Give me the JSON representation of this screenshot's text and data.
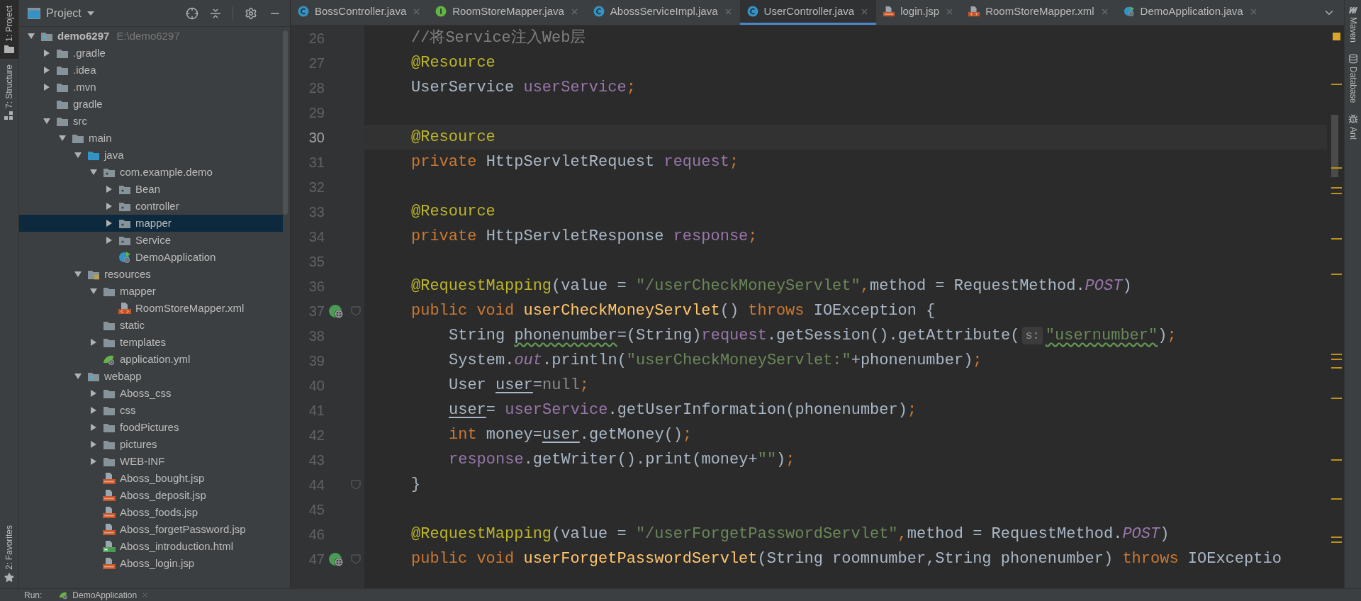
{
  "left_strip": [
    {
      "label": "1: Project",
      "selected": true,
      "kind": "project"
    },
    {
      "label": "7: Structure",
      "selected": false,
      "kind": "structure"
    }
  ],
  "left_strip_bottom": [
    {
      "label": "2: Favorites",
      "selected": false,
      "kind": "favorites"
    }
  ],
  "project_panel": {
    "title": "Project"
  },
  "tree": [
    {
      "name": "demo6297",
      "path": "E:\\demo6297",
      "kind": "module",
      "expanded": true,
      "selected": false,
      "children": [
        {
          "name": ".gradle",
          "kind": "folder",
          "expanded": false,
          "selected": false
        },
        {
          "name": ".idea",
          "kind": "folder",
          "expanded": false,
          "selected": false
        },
        {
          "name": ".mvn",
          "kind": "folder",
          "expanded": false,
          "selected": false
        },
        {
          "name": "gradle",
          "kind": "folder",
          "selected": false
        },
        {
          "name": "src",
          "kind": "folder",
          "expanded": true,
          "selected": false,
          "children": [
            {
              "name": "main",
              "kind": "folder",
              "expanded": true,
              "selected": false,
              "children": [
                {
                  "name": "java",
                  "kind": "source",
                  "expanded": true,
                  "selected": false,
                  "children": [
                    {
                      "name": "com.example.demo",
                      "kind": "package",
                      "expanded": true,
                      "selected": false,
                      "children": [
                        {
                          "name": "Bean",
                          "kind": "package",
                          "expanded": false,
                          "selected": false
                        },
                        {
                          "name": "controller",
                          "kind": "package",
                          "expanded": false,
                          "selected": false
                        },
                        {
                          "name": "mapper",
                          "kind": "package",
                          "expanded": false,
                          "selected": true
                        },
                        {
                          "name": "Service",
                          "kind": "package",
                          "expanded": false,
                          "selected": false
                        },
                        {
                          "name": "DemoApplication",
                          "kind": "boot",
                          "selected": false
                        }
                      ]
                    }
                  ]
                },
                {
                  "name": "resources",
                  "kind": "resources",
                  "expanded": true,
                  "selected": false,
                  "children": [
                    {
                      "name": "mapper",
                      "kind": "folder",
                      "expanded": true,
                      "selected": false,
                      "children": [
                        {
                          "name": "RoomStoreMapper.xml",
                          "kind": "xml",
                          "selected": false
                        }
                      ]
                    },
                    {
                      "name": "static",
                      "kind": "folder",
                      "selected": false
                    },
                    {
                      "name": "templates",
                      "kind": "folder",
                      "expanded": false,
                      "selected": false
                    },
                    {
                      "name": "application.yml",
                      "kind": "yml",
                      "selected": false
                    }
                  ]
                },
                {
                  "name": "webapp",
                  "kind": "web",
                  "expanded": true,
                  "selected": false,
                  "children": [
                    {
                      "name": "Aboss_css",
                      "kind": "folder",
                      "expanded": false,
                      "selected": false
                    },
                    {
                      "name": "css",
                      "kind": "folder",
                      "expanded": false,
                      "selected": false
                    },
                    {
                      "name": "foodPictures",
                      "kind": "folder",
                      "expanded": false,
                      "selected": false
                    },
                    {
                      "name": "pictures",
                      "kind": "folder",
                      "expanded": false,
                      "selected": false
                    },
                    {
                      "name": "WEB-INF",
                      "kind": "folder",
                      "expanded": false,
                      "selected": false
                    },
                    {
                      "name": "Aboss_bought.jsp",
                      "kind": "jsp",
                      "selected": false
                    },
                    {
                      "name": "Aboss_deposit.jsp",
                      "kind": "jsp",
                      "selected": false
                    },
                    {
                      "name": "Aboss_foods.jsp",
                      "kind": "jsp",
                      "selected": false
                    },
                    {
                      "name": "Aboss_forgetPassword.jsp",
                      "kind": "jsp",
                      "selected": false
                    },
                    {
                      "name": "Aboss_introduction.html",
                      "kind": "html",
                      "selected": false
                    },
                    {
                      "name": "Aboss_login.jsp",
                      "kind": "jsp",
                      "selected": false
                    }
                  ]
                }
              ]
            }
          ]
        }
      ]
    }
  ],
  "tabs": [
    {
      "label": "BossController.java",
      "kind": "class",
      "selected": false
    },
    {
      "label": "RoomStoreMapper.java",
      "kind": "interface",
      "selected": false
    },
    {
      "label": "AbossServiceImpl.java",
      "kind": "class",
      "selected": false
    },
    {
      "label": "UserController.java",
      "kind": "class",
      "selected": true
    },
    {
      "label": "login.jsp",
      "kind": "jsp",
      "selected": false
    },
    {
      "label": "RoomStoreMapper.xml",
      "kind": "xml",
      "selected": false
    },
    {
      "label": "DemoApplication.java",
      "kind": "boot",
      "selected": false
    }
  ],
  "code_lines": [
    {
      "number": "26",
      "kind": "member",
      "current": false,
      "run_icon": false,
      "fold": false,
      "tokens": [
        {
          "kind": "comment",
          "text": "//将Service注入Web层"
        }
      ]
    },
    {
      "number": "27",
      "kind": "member",
      "current": false,
      "run_icon": false,
      "fold": false,
      "tokens": [
        {
          "kind": "annotation",
          "text": "@Resource"
        }
      ]
    },
    {
      "number": "28",
      "kind": "member",
      "current": false,
      "run_icon": false,
      "fold": false,
      "tokens": [
        {
          "kind": "plain",
          "text": "UserService "
        },
        {
          "kind": "field",
          "text": "userService"
        },
        {
          "kind": "keyword",
          "text": ";"
        }
      ]
    },
    {
      "number": "29",
      "kind": "blank",
      "current": false,
      "run_icon": false,
      "fold": false
    },
    {
      "number": "30",
      "kind": "member",
      "current": true,
      "run_icon": false,
      "fold": false,
      "tokens": [
        {
          "kind": "annotation",
          "text": "@Resource"
        }
      ]
    },
    {
      "number": "31",
      "kind": "member",
      "current": false,
      "run_icon": false,
      "fold": false,
      "tokens": [
        {
          "kind": "keyword",
          "text": "private "
        },
        {
          "kind": "plain",
          "text": "HttpServletRequest "
        },
        {
          "kind": "field",
          "text": "request"
        },
        {
          "kind": "keyword",
          "text": ";"
        }
      ]
    },
    {
      "number": "32",
      "kind": "blank",
      "current": false,
      "run_icon": false,
      "fold": false
    },
    {
      "number": "33",
      "kind": "member",
      "current": false,
      "run_icon": false,
      "fold": false,
      "tokens": [
        {
          "kind": "annotation",
          "text": "@Resource"
        }
      ]
    },
    {
      "number": "34",
      "kind": "member",
      "current": false,
      "run_icon": false,
      "fold": false,
      "tokens": [
        {
          "kind": "keyword",
          "text": "private "
        },
        {
          "kind": "plain",
          "text": "HttpServletResponse "
        },
        {
          "kind": "field",
          "text": "response"
        },
        {
          "kind": "keyword",
          "text": ";"
        }
      ]
    },
    {
      "number": "35",
      "kind": "blank",
      "current": false,
      "run_icon": false,
      "fold": false
    },
    {
      "number": "36",
      "kind": "member",
      "current": false,
      "run_icon": false,
      "fold": false,
      "tokens": [
        {
          "kind": "annotation",
          "text": "@RequestMapping"
        },
        {
          "kind": "plain",
          "text": "(value = "
        },
        {
          "kind": "string",
          "text": "\"/userCheckMoneyServlet\""
        },
        {
          "kind": "keyword",
          "text": ","
        },
        {
          "kind": "plain",
          "text": "method = RequestMethod."
        },
        {
          "kind": "static",
          "text": "POST"
        },
        {
          "kind": "plain",
          "text": ")"
        }
      ]
    },
    {
      "number": "37",
      "kind": "member",
      "current": false,
      "run_icon": true,
      "fold": true,
      "tokens": [
        {
          "kind": "keyword",
          "text": "public void "
        },
        {
          "kind": "method",
          "text": "userCheckMoneyServlet"
        },
        {
          "kind": "plain",
          "text": "() "
        },
        {
          "kind": "keyword",
          "text": "throws "
        },
        {
          "kind": "plain",
          "text": "IOException {"
        }
      ]
    },
    {
      "number": "38",
      "kind": "body",
      "current": false,
      "run_icon": false,
      "fold": false,
      "tokens": [
        {
          "kind": "plain",
          "text": "String "
        },
        {
          "kind": "typo",
          "text": "phonenumber"
        },
        {
          "kind": "plain",
          "text": "=(String)"
        },
        {
          "kind": "field",
          "text": "request"
        },
        {
          "kind": "plain",
          "text": ".getSession().getAttribute("
        },
        {
          "kind": "hint",
          "text": "s:"
        },
        {
          "kind": "typo_string",
          "text": "\"usernumber\""
        },
        {
          "kind": "plain",
          "text": ")"
        },
        {
          "kind": "keyword",
          "text": ";"
        }
      ]
    },
    {
      "number": "39",
      "kind": "body",
      "current": false,
      "run_icon": false,
      "fold": false,
      "tokens": [
        {
          "kind": "plain",
          "text": "System."
        },
        {
          "kind": "static",
          "text": "out"
        },
        {
          "kind": "plain",
          "text": ".println("
        },
        {
          "kind": "string",
          "text": "\"userCheckMoneyServlet:\""
        },
        {
          "kind": "plain",
          "text": "+phonenumber)"
        },
        {
          "kind": "keyword",
          "text": ";"
        }
      ]
    },
    {
      "number": "40",
      "kind": "body",
      "current": false,
      "run_icon": false,
      "fold": false,
      "tokens": [
        {
          "kind": "plain",
          "text": "User "
        },
        {
          "kind": "reassigned",
          "text": "user"
        },
        {
          "kind": "plain",
          "text": "="
        },
        {
          "kind": "null",
          "text": "null"
        },
        {
          "kind": "keyword",
          "text": ";"
        }
      ]
    },
    {
      "number": "41",
      "kind": "body",
      "current": false,
      "run_icon": false,
      "fold": false,
      "tokens": [
        {
          "kind": "reassigned",
          "text": "user"
        },
        {
          "kind": "plain",
          "text": "= "
        },
        {
          "kind": "field",
          "text": "userService"
        },
        {
          "kind": "plain",
          "text": ".getUserInformation(phonenumber)"
        },
        {
          "kind": "keyword",
          "text": ";"
        }
      ]
    },
    {
      "number": "42",
      "kind": "body",
      "current": false,
      "run_icon": false,
      "fold": false,
      "tokens": [
        {
          "kind": "keyword",
          "text": "int "
        },
        {
          "kind": "plain",
          "text": "money="
        },
        {
          "kind": "reassigned",
          "text": "user"
        },
        {
          "kind": "plain",
          "text": ".getMoney()"
        },
        {
          "kind": "keyword",
          "text": ";"
        }
      ]
    },
    {
      "number": "43",
      "kind": "body",
      "current": false,
      "run_icon": false,
      "fold": false,
      "tokens": [
        {
          "kind": "field",
          "text": "response"
        },
        {
          "kind": "plain",
          "text": ".getWriter().print(money+"
        },
        {
          "kind": "string",
          "text": "\"\""
        },
        {
          "kind": "plain",
          "text": ")"
        },
        {
          "kind": "keyword",
          "text": ";"
        }
      ]
    },
    {
      "number": "44",
      "kind": "member",
      "current": false,
      "run_icon": false,
      "fold": true,
      "tokens": [
        {
          "kind": "plain",
          "text": "}"
        }
      ]
    },
    {
      "number": "45",
      "kind": "blank",
      "current": false,
      "run_icon": false,
      "fold": false
    },
    {
      "number": "46",
      "kind": "member",
      "current": false,
      "run_icon": false,
      "fold": false,
      "tokens": [
        {
          "kind": "annotation",
          "text": "@RequestMapping"
        },
        {
          "kind": "plain",
          "text": "(value = "
        },
        {
          "kind": "string",
          "text": "\"/userForgetPasswordServlet\""
        },
        {
          "kind": "keyword",
          "text": ","
        },
        {
          "kind": "plain",
          "text": "method = RequestMethod."
        },
        {
          "kind": "static",
          "text": "POST"
        },
        {
          "kind": "plain",
          "text": ")"
        }
      ]
    },
    {
      "number": "47",
      "kind": "member",
      "current": false,
      "run_icon": true,
      "fold": true,
      "tokens": [
        {
          "kind": "keyword",
          "text": "public void "
        },
        {
          "kind": "method",
          "text": "userForgetPasswordServlet"
        },
        {
          "kind": "plain",
          "text": "(String roomnumber,String phonenumber) "
        },
        {
          "kind": "keyword",
          "text": "throws "
        },
        {
          "kind": "plain",
          "text": "IOExceptio"
        }
      ]
    }
  ],
  "right_strip": [
    {
      "label": "Maven",
      "kind": "maven"
    },
    {
      "label": "Database",
      "kind": "database"
    },
    {
      "label": "Ant",
      "kind": "ant"
    }
  ],
  "run_bar": {
    "label": "Run:",
    "tab": "DemoApplication"
  }
}
